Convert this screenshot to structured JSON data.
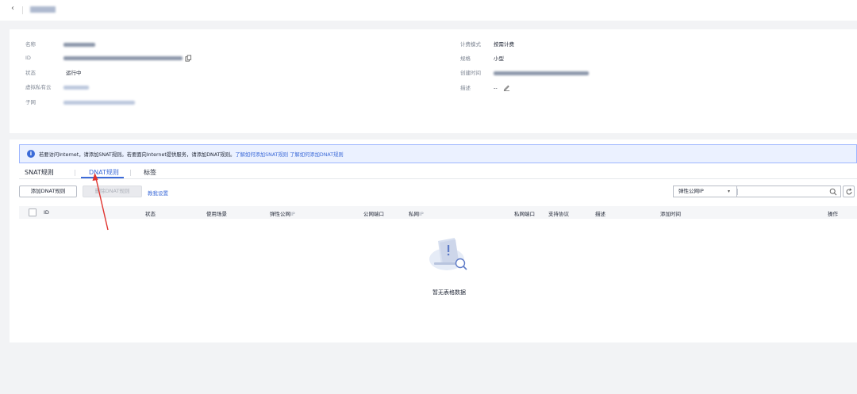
{
  "header": {
    "back_icon": "chevron-left-icon",
    "title": ""
  },
  "info": {
    "left": [
      {
        "label": "名称",
        "value": ""
      },
      {
        "label": "ID",
        "value": ""
      },
      {
        "label": "状态",
        "value": "运行中"
      },
      {
        "label": "虚拟私有云",
        "value": ""
      },
      {
        "label": "子网",
        "value": ""
      }
    ],
    "right": [
      {
        "label": "计费模式",
        "value": "按需计费"
      },
      {
        "label": "规格",
        "value": "小型"
      },
      {
        "label": "创建时间",
        "value": ""
      },
      {
        "label": "描述",
        "value": "--"
      }
    ]
  },
  "notice": {
    "text": "若要访问Internet，请添加SNAT规则。若要面向Internet提供服务，请添加DNAT规则。",
    "link1": "了解如何添加SNAT规则",
    "link2": "了解如何添加DNAT规则"
  },
  "tabs": [
    {
      "label": "SNAT规则",
      "active": false
    },
    {
      "label": "DNAT规则",
      "active": true
    },
    {
      "label": "标签",
      "active": false
    }
  ],
  "toolbar": {
    "add_label": "添加DNAT规则",
    "delete_label": "删除DNAT规则",
    "guide_label": "教我设置",
    "filter_value": "弹性公网IP",
    "search_value": ""
  },
  "table": {
    "columns": [
      {
        "label": "ID"
      },
      {
        "label": "状态"
      },
      {
        "label": "使用场景"
      },
      {
        "label": "弹性公网",
        "suffix": "IP"
      },
      {
        "label": "公网端口"
      },
      {
        "label": "私网",
        "suffix": "IP"
      },
      {
        "label": "私网端口"
      },
      {
        "label": "支持协议"
      },
      {
        "label": "描述"
      },
      {
        "label": "添加时间"
      },
      {
        "label": "操作"
      }
    ],
    "empty_text": "暂无表格数据"
  },
  "colors": {
    "accent": "#3d6bd8",
    "arrow": "#e0342f",
    "notice_bg": "#ebf1ff"
  }
}
